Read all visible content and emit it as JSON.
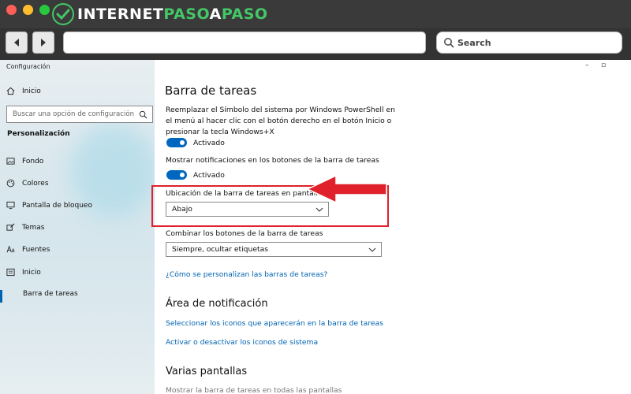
{
  "brand": {
    "part1": "INTERNET",
    "part2": "PASO",
    "part3": "A",
    "part4": "PASO"
  },
  "toolbar": {
    "search_label": "Search"
  },
  "window": {
    "title": "Configuración",
    "min_glyph": "–",
    "max_glyph": "▫"
  },
  "sidebar": {
    "home": "Inicio",
    "search_placeholder": "Buscar una opción de configuración",
    "section": "Personalización",
    "items": [
      "Fondo",
      "Colores",
      "Pantalla de bloqueo",
      "Temas",
      "Fuentes",
      "Inicio",
      "Barra de tareas"
    ]
  },
  "content": {
    "title": "Barra de tareas",
    "ps_text": "Reemplazar el Símbolo del sistema por Windows PowerShell en el menú al hacer clic con el botón derecho en el botón Inicio o presionar la tecla Windows+X",
    "ps_state": "Activado",
    "badges_text": "Mostrar notificaciones en los botones de la barra de tareas",
    "badges_state": "Activado",
    "location_label": "Ubicación de la barra de tareas en pantalla",
    "location_value": "Abajo",
    "combine_label": "Combinar los botones de la barra de tareas",
    "combine_value": "Siempre, ocultar etiquetas",
    "help_link": "¿Cómo se personalizan las barras de tareas?",
    "notif_heading": "Área de notificación",
    "notif_link1": "Seleccionar los iconos que aparecerán en la barra de tareas",
    "notif_link2": "Activar o desactivar los iconos de sistema",
    "multi_heading": "Varias pantallas",
    "multi_text": "Mostrar la barra de tareas en todas las pantallas"
  },
  "colors": {
    "accent": "#0067c0",
    "link": "#0063b1",
    "highlight": "#e0202a",
    "brand_green": "#44c767"
  }
}
